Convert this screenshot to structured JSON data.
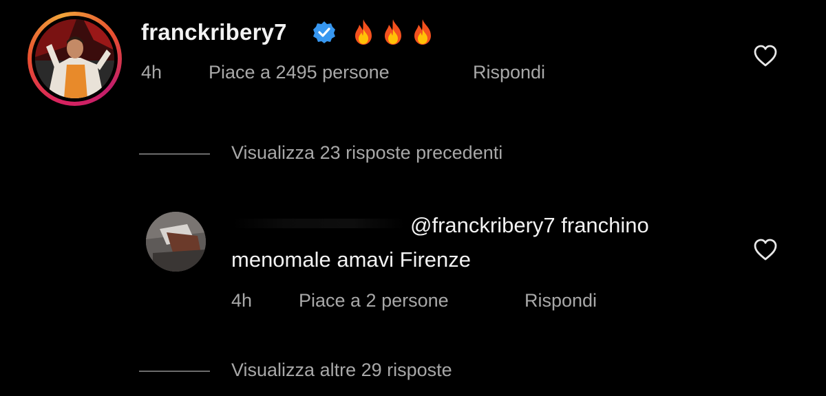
{
  "comment": {
    "username": "franckribery7",
    "emoji": [
      "🔥",
      "🔥",
      "🔥"
    ],
    "time": "4h",
    "likes": "Piace a 2495 persone",
    "reply_label": "Rispondi"
  },
  "view_previous_replies": "Visualizza 23 risposte precedenti",
  "reply": {
    "mention_line": "@franckribery7 franchino",
    "text_line": "menomale amavi Firenze",
    "time": "4h",
    "likes": "Piace a 2 persone",
    "reply_label": "Rispondi"
  },
  "view_more_replies": "Visualizza altre 29 risposte",
  "colors": {
    "background": "#000000",
    "primary_text": "#f2f2f2",
    "secondary_text": "#a8a8a8",
    "verified_badge": "#3797f0",
    "story_ring": "#d8235f"
  },
  "icons": [
    "verified-badge-icon",
    "fire-emoji-icon",
    "heart-icon"
  ]
}
